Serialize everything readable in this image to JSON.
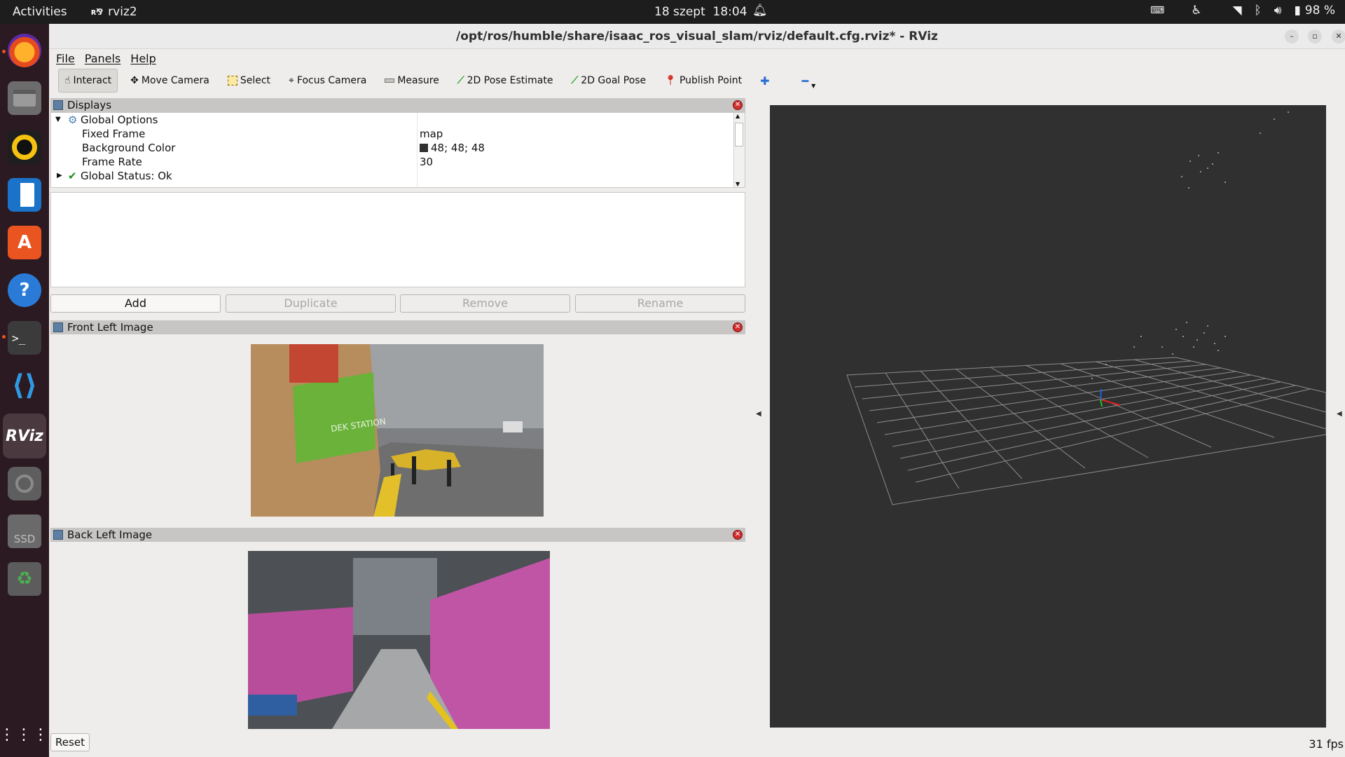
{
  "topbar": {
    "activities": "Activities",
    "app_name": "rviz2",
    "date": "18 szept",
    "time": "18:04",
    "battery": "98 %"
  },
  "dock": {
    "items": [
      "firefox-icon",
      "files-icon",
      "rhythmbox-icon",
      "writer-icon",
      "app-center-icon",
      "help-icon",
      "terminal-icon",
      "vscode-icon",
      "rviz-icon",
      "disk-icon",
      "ssd-icon",
      "trash-icon"
    ],
    "rviz_label": "RViz",
    "ssd_label": "SSD"
  },
  "window": {
    "title": "/opt/ros/humble/share/isaac_ros_visual_slam/rviz/default.cfg.rviz* - RViz"
  },
  "menu": [
    "File",
    "Panels",
    "Help"
  ],
  "toolbar": {
    "tools": [
      "Interact",
      "Move Camera",
      "Select",
      "Focus Camera",
      "Measure",
      "2D Pose Estimate",
      "2D Goal Pose",
      "Publish Point"
    ]
  },
  "displays": {
    "title": "Displays",
    "global_options": "Global Options",
    "fixed_frame_label": "Fixed Frame",
    "fixed_frame_value": "map",
    "background_color_label": "Background Color",
    "background_color_value": "48; 48; 48",
    "frame_rate_label": "Frame Rate",
    "frame_rate_value": "30",
    "global_status": "Global Status: Ok",
    "background_color_hex": "#303030"
  },
  "buttons": {
    "add": "Add",
    "duplicate": "Duplicate",
    "remove": "Remove",
    "rename": "Rename",
    "reset": "Reset"
  },
  "images": {
    "front_left_title": "Front Left Image",
    "back_left_title": "Back Left Image",
    "box_label": "DEK STATION"
  },
  "status": {
    "fps": "31 fps"
  }
}
